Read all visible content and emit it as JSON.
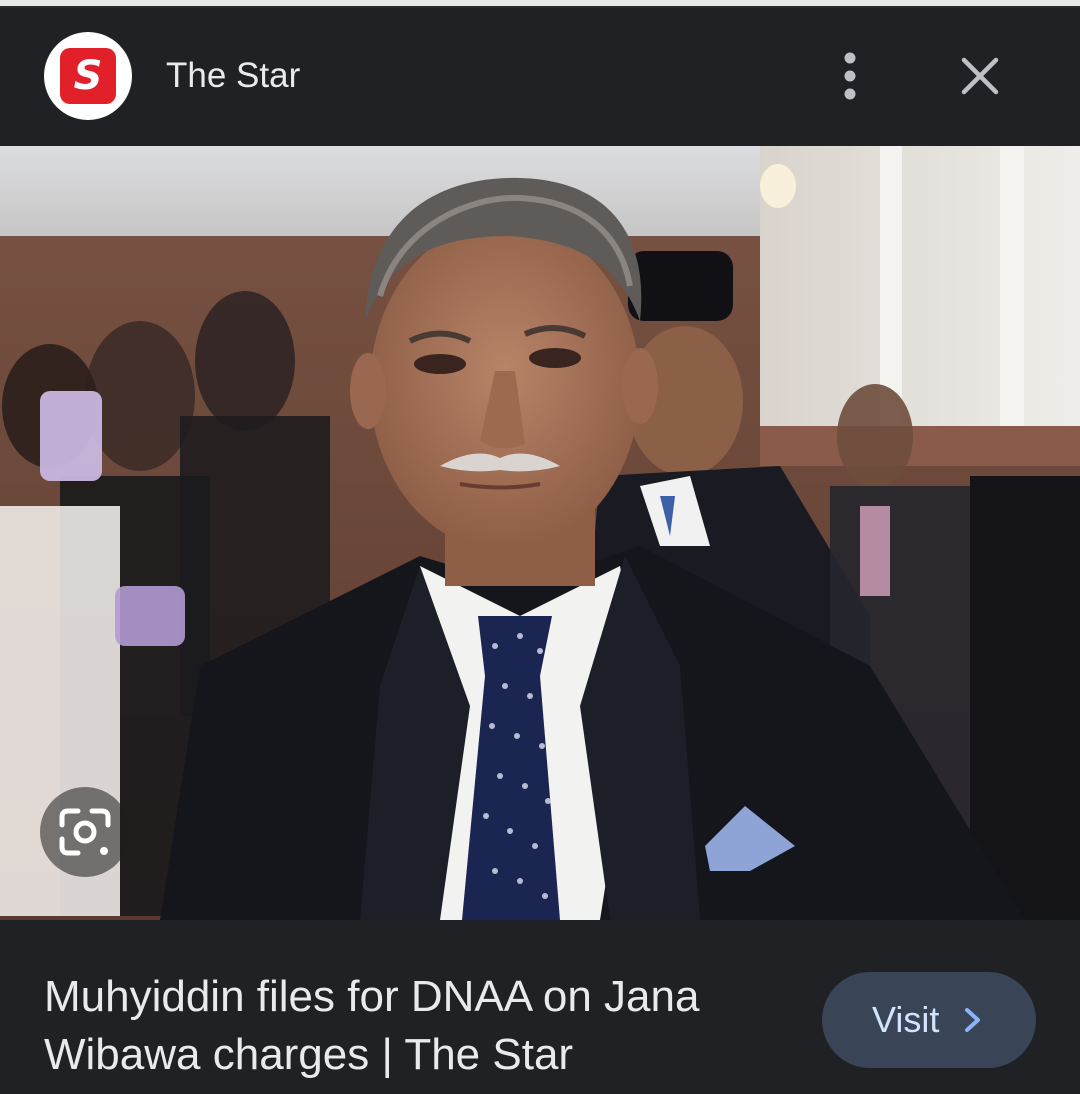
{
  "header": {
    "source_name": "The Star",
    "logo_letter": "S",
    "logo_color": "#e1202a"
  },
  "image": {
    "description_icon": "photo-of-man-in-suit"
  },
  "lens": {
    "icon": "lens-search-icon"
  },
  "caption": {
    "title": "Muhyiddin files for DNAA on Jana Wibawa charges | The Star"
  },
  "visit_button": {
    "label": "Visit"
  },
  "colors": {
    "background": "#202124",
    "button_bg": "#394457",
    "button_text": "#d2e3fc",
    "text": "#e8eaed"
  }
}
